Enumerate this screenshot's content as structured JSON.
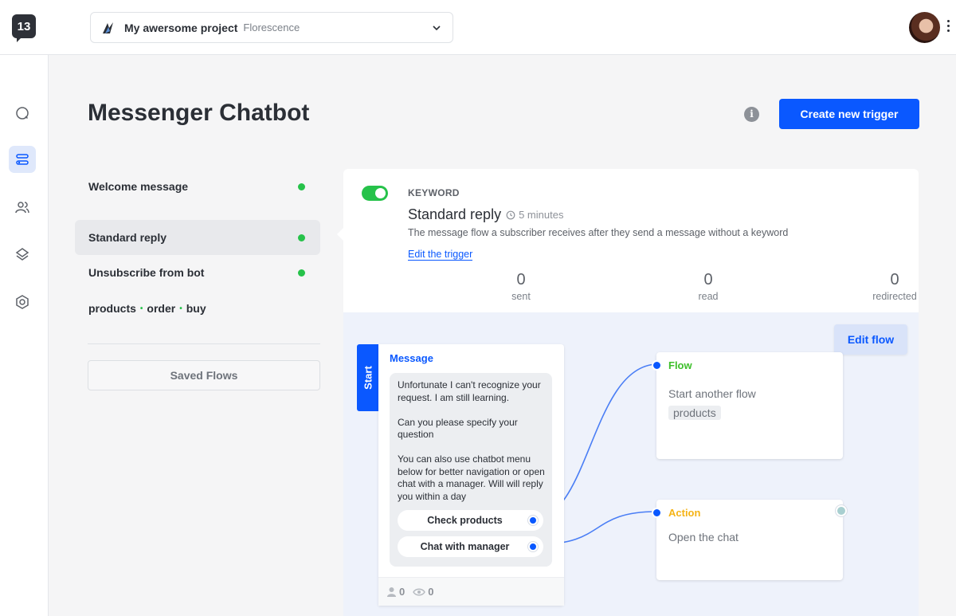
{
  "app": {
    "logo_text": "13",
    "project_name": "My awersome project",
    "project_sub": "Florescence"
  },
  "page": {
    "title": "Messenger Chatbot",
    "create_button": "Create new trigger"
  },
  "triggers": [
    {
      "label": "Welcome message",
      "active": false,
      "enabled": true
    },
    {
      "label": "Standard reply",
      "active": true,
      "enabled": true
    },
    {
      "label": "Unsubscribe from bot",
      "active": false,
      "enabled": true
    }
  ],
  "keywords": [
    "products",
    "order",
    "buy"
  ],
  "keyword_separator": "•",
  "saved_flows": "Saved Flows",
  "detail": {
    "type_label": "KEYWORD",
    "title": "Standard reply",
    "time": "5 minutes",
    "description": "The message flow a subscriber receives after they send a message without a keyword",
    "edit_link": "Edit the trigger",
    "stats": [
      {
        "value": "0",
        "label": "sent"
      },
      {
        "value": "0",
        "label": "read"
      },
      {
        "value": "0",
        "label": "redirected"
      }
    ],
    "enabled": true
  },
  "flow": {
    "edit_button": "Edit flow",
    "start_label": "Start",
    "message": {
      "title": "Message",
      "text": "Unfortunate I can't recognize your request. I am still learning.\n\nCan you please specify your question\n\nYou can also use chatbot menu below for better navigation or open chat with a manager. Will will reply you within a day",
      "buttons": [
        "Check products",
        "Chat with manager"
      ],
      "subscribers": "0",
      "views": "0"
    },
    "flow_node": {
      "title": "Flow",
      "body": "Start another flow",
      "tag": "products"
    },
    "action_node": {
      "title": "Action",
      "body": "Open the chat"
    }
  },
  "colors": {
    "primary": "#0a58ff",
    "green": "#26c24a",
    "flow_title": "#3dbf2a",
    "action_title": "#f5b315"
  }
}
